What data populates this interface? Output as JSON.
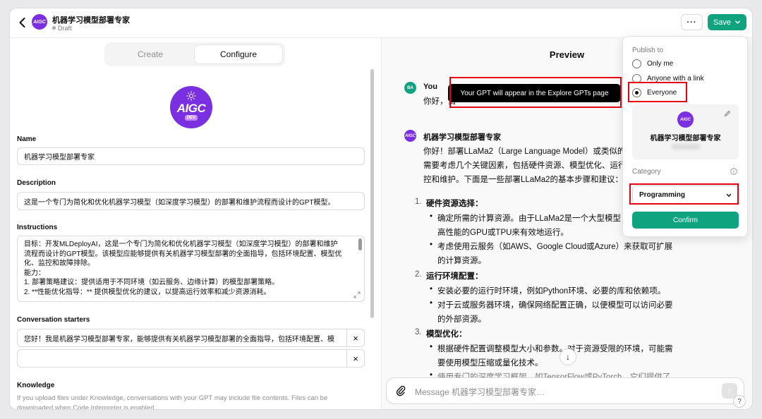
{
  "header": {
    "title": "机器学习模型部署专家",
    "status": "Draft",
    "more_label": "···",
    "save_label": "Save",
    "logo_text": "AIGC"
  },
  "tabs": {
    "create": "Create",
    "configure": "Configure",
    "active": "Configure"
  },
  "avatar": {
    "line1": "AIGC",
    "line2": "DEV"
  },
  "form": {
    "name_label": "Name",
    "name_value": "机器学习模型部署专家",
    "description_label": "Description",
    "description_value": "这是一个专门为简化和优化机器学习模型（如深度学习模型）的部署和维护流程而设计的GPT模型。",
    "instructions_label": "Instructions",
    "instructions_lines": [
      "目标：开发MLDeployAI，这是一个专门为简化和优化机器学习模型（如深度学习模型）的部署和维护",
      "流程而设计的GPT模型。该模型应能够提供有关机器学习模型部署的全面指导，包括环境配置、模型优",
      "化、监控和故障排除。",
      "能力：",
      "1. 部署策略建议：提供适用于不同环境（如云服务、边缘计算）的模型部署策略。",
      "2. **性能优化指导：** 提供模型优化的建议，以提高运行效率和减少资源消耗。"
    ],
    "starters_label": "Conversation starters",
    "starter_1": "您好！我是机器学习模型部署专家，能够提供有关机器学习模型部署的全面指导，包括环境配置、模",
    "starter_2": "",
    "starter_remove": "×",
    "knowledge_label": "Knowledge",
    "knowledge_note": "If you upload files under Knowledge, conversations with your GPT may include file contents. Files can be downloaded when Code Interpreter is enabled"
  },
  "preview": {
    "title": "Preview",
    "user_initials": "BA",
    "user_name": "You",
    "user_msg": "你好，请",
    "bot_name": "机器学习模型部署专家",
    "bot_intro": [
      "你好！部署LLaMa2（Large Language Model）或类似的",
      "需要考虑几个关键因素，包括硬件资源、模型优化、运行",
      "控和维护。下面是一些部署LLaMa2的基本步骤和建议："
    ],
    "steps": [
      {
        "num": "1.",
        "title": "硬件资源选择：",
        "bullets": [
          [
            "确定所需的计算资源。由于LLaMa2是一个大型模型",
            "高性能的GPU或TPU来有效地运行。"
          ],
          [
            "考虑使用云服务（如AWS、Google Cloud或Azure）来获取可扩展",
            "的计算资源。"
          ]
        ]
      },
      {
        "num": "2.",
        "title": "运行环境配置：",
        "bullets": [
          [
            "安装必要的运行时环境，例如Python环境、必要的库和依赖项。"
          ],
          [
            "对于云或服务器环境，确保网络配置正确，以便模型可以访问必要",
            "的外部资源。"
          ]
        ]
      },
      {
        "num": "3.",
        "title": "模型优化：",
        "bullets": [
          [
            "根据硬件配置调整模型大小和参数。对于资源受限的环境，可能需",
            "要使用模型压缩或量化技术。"
          ],
          [
            "使用专门的深度学习框架，如TensorFlow或PyTorch，它们提供了"
          ]
        ]
      }
    ],
    "scroll_down": "↓",
    "composer_placeholder": "Message 机器学习模型部署专家…",
    "send_icon": "↑",
    "help": "?"
  },
  "tooltip": "Your GPT will appear in the Explore GPTs page",
  "publish": {
    "label": "Publish to",
    "options": [
      "Only me",
      "Anyone with a link",
      "Everyone"
    ],
    "selected": "Everyone",
    "card_name": "机器学习模型部署专家",
    "card_icon_text": "AIGC",
    "category_label": "Category",
    "category_value": "Programming",
    "confirm_label": "Confirm"
  },
  "colors": {
    "accent": "#10a37f",
    "brand": "#7a2fe0",
    "highlight": "#e60012"
  }
}
